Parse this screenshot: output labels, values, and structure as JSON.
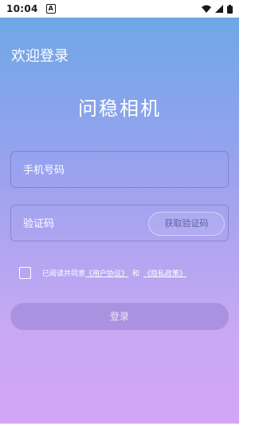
{
  "status_bar": {
    "time": "10:04",
    "indicator": "A"
  },
  "header": {
    "greeting": "欢迎登录",
    "app_name": "问稳相机"
  },
  "form": {
    "phone_placeholder": "手机号码",
    "code_placeholder": "验证码",
    "get_code_label": "获取验证码"
  },
  "agreement": {
    "prefix": "已阅读并同意",
    "user_agreement": "《用户协议》",
    "and": "和",
    "privacy_policy": "《隐私政策》"
  },
  "login_label": "登录",
  "colors": {
    "gradient_top": "#6aa8e6",
    "gradient_bottom": "#d3a6f6",
    "status_bar_bg": "#ffffff"
  },
  "icons": [
    "wifi-icon",
    "cellular-signal-icon",
    "battery-icon"
  ]
}
